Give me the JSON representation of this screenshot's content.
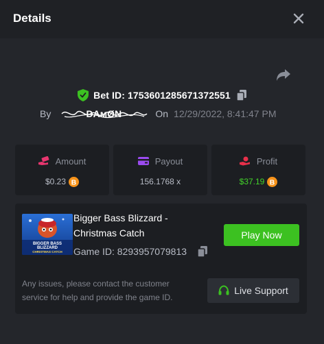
{
  "header": {
    "title": "Details"
  },
  "bet": {
    "id_label": "Bet ID: 1753601285671372551",
    "by_label": "By",
    "username": "DAмØN",
    "on_label": "On",
    "date": "12/29/2022, 8:41:47 PM"
  },
  "stats": {
    "amount": {
      "label": "Amount",
      "value": "$0.23",
      "icon": "money-hand-icon",
      "currency_icon": "bitcoin-icon"
    },
    "payout": {
      "label": "Payout",
      "value": "156.1768 x",
      "icon": "wallet-card-icon"
    },
    "profit": {
      "label": "Profit",
      "value": "$37.19",
      "icon": "hand-coin-icon",
      "currency_icon": "bitcoin-icon"
    }
  },
  "game": {
    "title": "Bigger Bass Blizzard - Christmas Catch",
    "thumb_text": [
      "BIGGER BASS",
      "BLIZZARD",
      "CHRISTMAS CATCH"
    ],
    "id_label": "Game ID: 8293957079813",
    "play_label": "Play Now"
  },
  "support": {
    "help_text": "Any issues, please contact the customer service for help and provide the game ID.",
    "button_label": "Live Support"
  },
  "colors": {
    "background": "#24262b",
    "card": "#1c1e22",
    "accent_green": "#3cc121",
    "profit_green": "#43d42a",
    "icon_pink": "#e8366f",
    "icon_purple": "#9b4bf0",
    "icon_red": "#e8304a",
    "bitcoin": "#f7931a"
  }
}
